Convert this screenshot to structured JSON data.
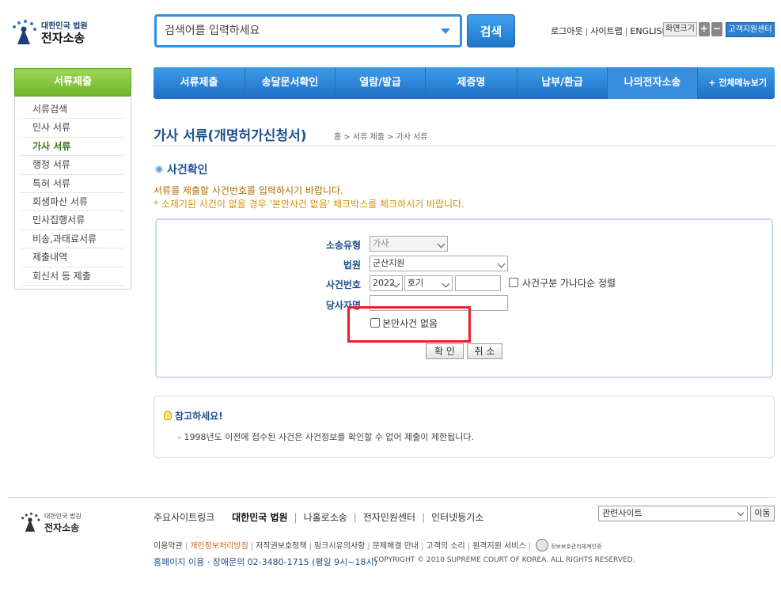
{
  "header": {
    "logo_small": "대한민국 법원",
    "logo_big": "전자소송",
    "search_placeholder": "검색어를 입력하세요",
    "search_button": "검색",
    "util_links": [
      "로그아웃",
      "사이트맵",
      "ENGLISH"
    ],
    "font_size_label": "화면크기",
    "font_plus": "+",
    "font_minus": "−",
    "help_center": "고객지원센터"
  },
  "gnb": {
    "items": [
      "서류제출",
      "송달문서확인",
      "열람/발급",
      "제증명",
      "납부/환급",
      "나의전자소송"
    ],
    "all_menu": "+ 전체메뉴보기"
  },
  "sidebar": {
    "title": "서류제출",
    "items": [
      "서류검색",
      "민사 서류",
      "가사 서류",
      "행정 서류",
      "특허 서류",
      "회생파산 서류",
      "민사집행서류",
      "비송,과태료서류",
      "제출내역",
      "회신서 등 제출"
    ],
    "active_index": 2
  },
  "page": {
    "title": "가사 서류(개명허가신청서)",
    "breadcrumb": "홈 > 서류 제출 > 가사 서류",
    "section_title": "사건확인",
    "guide1": "서류를 제출할 사건번호를 입력하시기 바랍니다.",
    "guide2": "* 소제기된 사건이 없을 경우 '본안사건 없음' 체크박스를 체크하시기 바랍니다."
  },
  "form": {
    "label_type": "소송유형",
    "type_value": "가사",
    "label_court": "법원",
    "court_value": "군산지원",
    "label_case": "사건번호",
    "year_value": "2022",
    "code_value": "호기",
    "number_value": "",
    "sort_label": "사건구분 가나다순 정렬",
    "label_party": "당사자명",
    "party_value": "",
    "no_case_label": "본안사건 없음",
    "confirm": "확 인",
    "cancel": "취 소"
  },
  "notice": {
    "title": "참고하세요!",
    "text": "- 1998년도 이전에 접수된 사건은 사건정보를 확인할 수 없어 제출이 제한됩니다."
  },
  "footer": {
    "logo_small": "대한민국 법원",
    "logo_big": "전자소송",
    "sites_label": "주요사이트링크",
    "sites": [
      "대한민국 법원",
      "나홀로소송",
      "전자민원센터",
      "인터넷등기소"
    ],
    "related_select": "관련사이트",
    "go": "이동",
    "links": [
      "이용약관",
      "개인정보처리방침",
      "저작권보호정책",
      "링크시유의사항",
      "문제해결 안내",
      "고객의 소리",
      "원격지원 서비스"
    ],
    "cert_label": "정보보호관리체계인증",
    "contact": "홈페이지 이용 · 장애문의 02-3480-1715 (평일 9시~18시)",
    "copyright": "COPYRIGHT © 2010 SUPREME COURT OF KOREA. ALL RIGHTS RESERVED."
  }
}
